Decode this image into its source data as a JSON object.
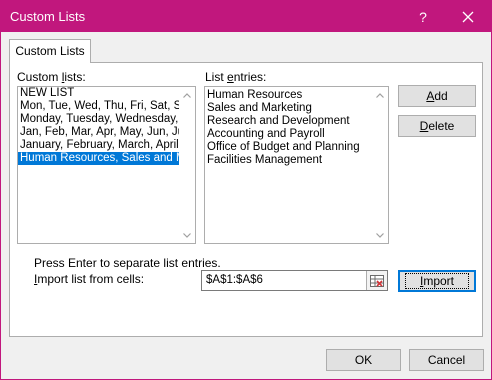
{
  "window": {
    "title": "Custom Lists",
    "help_glyph": "?",
    "accent": "#c1177d"
  },
  "tab": {
    "label": "Custom Lists"
  },
  "custom_lists": {
    "label_before": "Custom ",
    "label_accel": "l",
    "label_after": "ists:",
    "items": [
      "NEW LIST",
      "Mon, Tue, Wed, Thu, Fri, Sat, Sun",
      "Monday, Tuesday, Wednesday, Thursday, Friday, Saturday, Sunday",
      "Jan, Feb, Mar, Apr, May, Jun, Jul, Aug, Sep, Oct, Nov, Dec",
      "January, February, March, April, May, June, July, August, September, October, November, December",
      "Human Resources, Sales and Marketing, Research and Development, Accounting and Payroll, Office of Budget and Planning, Facilities Management"
    ],
    "selected_index": 5
  },
  "list_entries": {
    "label_before": "List ",
    "label_accel": "e",
    "label_after": "ntries:",
    "items": [
      "Human Resources",
      "Sales and Marketing",
      "Research and Development",
      "Accounting and Payroll",
      "Office of Budget and Planning",
      "Facilities Management"
    ]
  },
  "buttons": {
    "add_accel": "A",
    "add_rest": "dd",
    "delete_accel": "D",
    "delete_rest": "elete",
    "import_accel": "I",
    "import_rest": "mport",
    "ok": "OK",
    "cancel": "Cancel"
  },
  "hint": "Press Enter to separate list entries.",
  "import_from": {
    "label_before": "",
    "label_accel": "I",
    "label_after": "mport list from cells:",
    "value": "$A$1:$A$6"
  }
}
